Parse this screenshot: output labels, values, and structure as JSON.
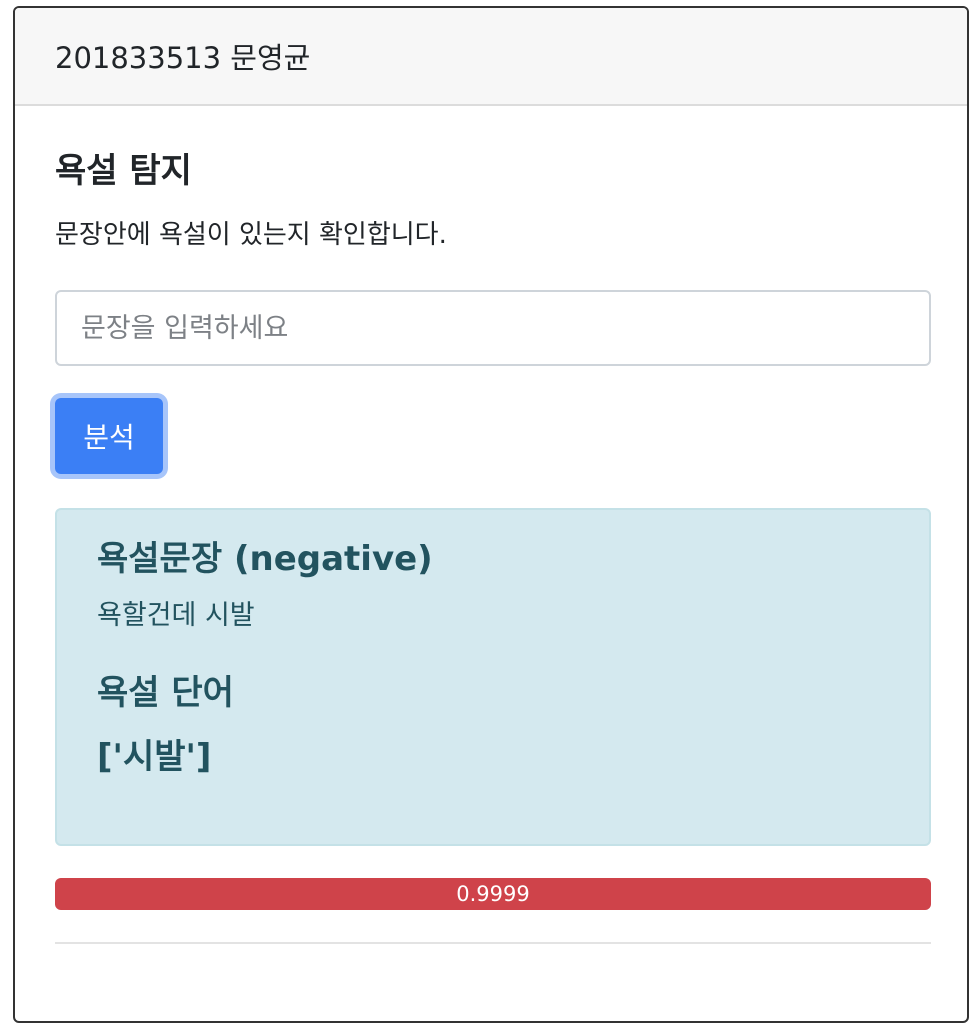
{
  "header": {
    "title": "201833513 문영균"
  },
  "main": {
    "title": "욕설 탐지",
    "description": "문장안에 욕설이 있는지 확인합니다.",
    "input": {
      "value": "",
      "placeholder": "문장을 입력하세요"
    },
    "analyze_button_label": "분석"
  },
  "result": {
    "title": "욕설문장 (negative)",
    "sentence": "욕할건데 시발",
    "words_title": "욕설 단어",
    "words": "['시발']"
  },
  "progress": {
    "label": "0.9999",
    "value": 0.9999
  },
  "colors": {
    "primary": "#3b7ff5",
    "danger": "#cf434a",
    "info_bg": "#d4e9ef",
    "info_text": "#22535f"
  }
}
